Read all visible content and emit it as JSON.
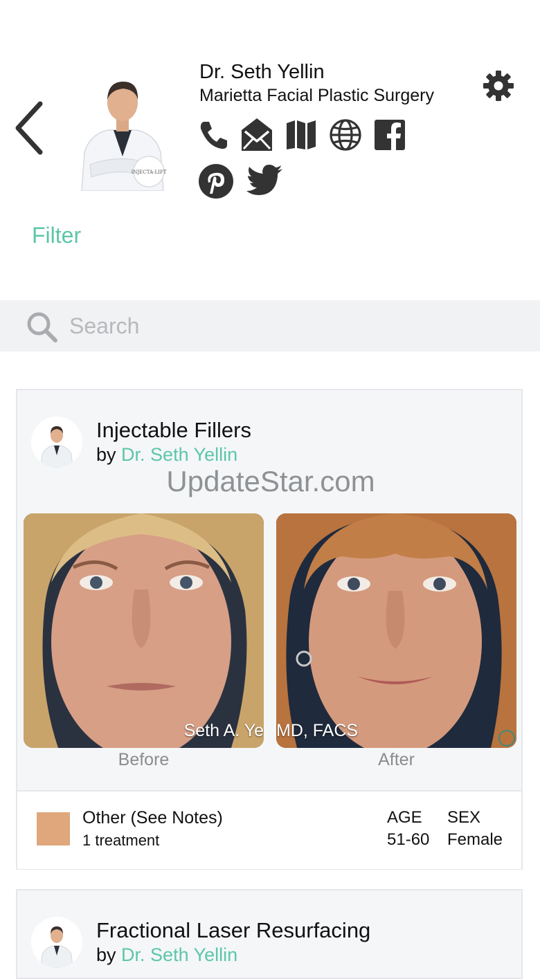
{
  "header": {
    "doctor_name": "Dr. Seth Yellin",
    "practice": "Marietta Facial Plastic Surgery",
    "social_icons": [
      "phone-icon",
      "email-icon",
      "map-icon",
      "globe-icon",
      "facebook-icon",
      "pinterest-icon",
      "twitter-icon"
    ],
    "avatar_badge": "INJECTA-LIFT"
  },
  "filter_label": "Filter",
  "search": {
    "placeholder": "Search"
  },
  "colors": {
    "accent": "#5cc6a8",
    "swatch": "#dfa77b"
  },
  "cards": [
    {
      "title": "Injectable Fillers",
      "by_prefix": "by",
      "by_name": "Dr. Seth Yellin",
      "watermark": "UpdateStar.com",
      "before_label": "Before",
      "after_label": "After",
      "overlay_left": "Seth A. Ye",
      "overlay_right": "MD, FACS",
      "procedure": "Other (See Notes)",
      "treatments": "1 treatment",
      "age_label": "AGE",
      "age_value": "51-60",
      "sex_label": "SEX",
      "sex_value": "Female"
    },
    {
      "title": "Fractional Laser Resurfacing",
      "by_prefix": "by",
      "by_name": "Dr. Seth Yellin"
    }
  ]
}
